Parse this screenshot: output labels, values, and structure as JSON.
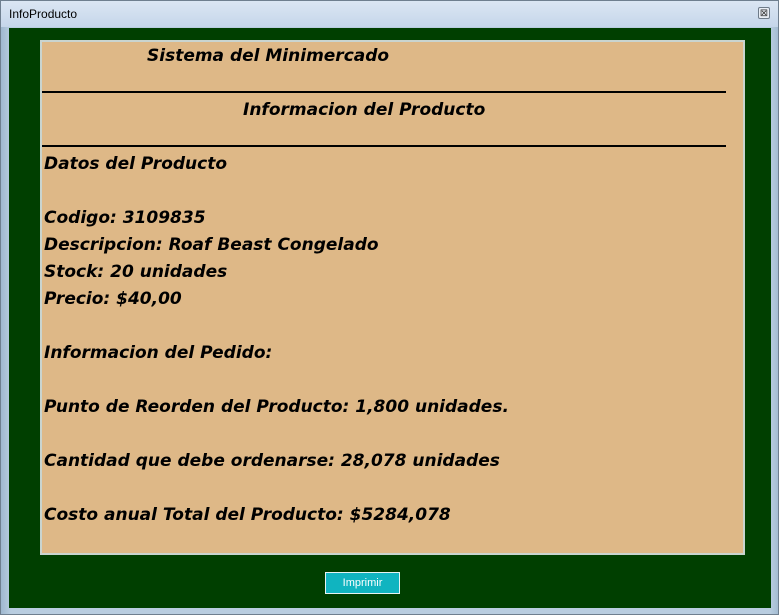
{
  "window": {
    "title": "InfoProducto",
    "close_glyph": "⊠"
  },
  "report": {
    "system_name": "Sistema del Minimercado",
    "section_title": "Informacion del Producto",
    "product_header": "Datos del Producto",
    "codigo": "Codigo: 3109835",
    "descripcion": "Descripcion: Roaf Beast Congelado",
    "stock": "Stock: 20 unidades",
    "precio": "Precio: $40,00",
    "order_header": "Informacion del Pedido:",
    "reorder_point": "Punto de Reorden del Producto: 1,800 unidades.",
    "order_quantity": "Cantidad que debe ordenarse: 28,078 unidades",
    "annual_cost": "Costo anual Total del Producto: $5284,078"
  },
  "actions": {
    "print_label": "Imprimir"
  },
  "colors": {
    "background": "#003f00",
    "panel": "#deb887",
    "button": "#10b4c0"
  }
}
